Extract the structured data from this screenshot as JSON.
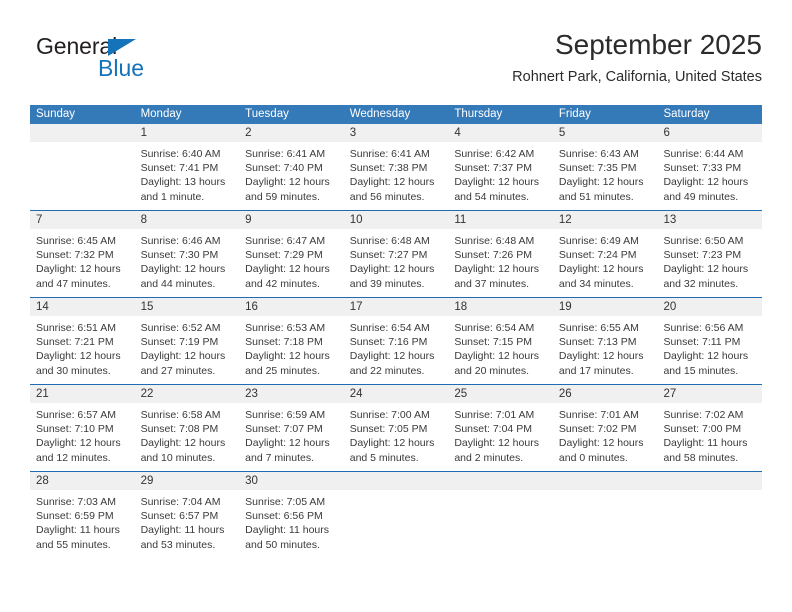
{
  "brand": {
    "name_top": "General",
    "name_bottom": "Blue",
    "accent_color": "#1573ba",
    "triangle_icon": "brand-triangle-icon"
  },
  "header": {
    "title": "September 2025",
    "subtitle": "Rohnert Park, California, United States"
  },
  "colors": {
    "header_bar": "#3479b8",
    "week_divider": "#1f6cb0",
    "day_band": "#f0f0f0",
    "text": "#3a3a3a"
  },
  "weekday_headers": [
    "Sunday",
    "Monday",
    "Tuesday",
    "Wednesday",
    "Thursday",
    "Friday",
    "Saturday"
  ],
  "weeks": [
    [
      {
        "day": "",
        "lines": []
      },
      {
        "day": "1",
        "lines": [
          "Sunrise: 6:40 AM",
          "Sunset: 7:41 PM",
          "Daylight: 13 hours",
          "and 1 minute."
        ]
      },
      {
        "day": "2",
        "lines": [
          "Sunrise: 6:41 AM",
          "Sunset: 7:40 PM",
          "Daylight: 12 hours",
          "and 59 minutes."
        ]
      },
      {
        "day": "3",
        "lines": [
          "Sunrise: 6:41 AM",
          "Sunset: 7:38 PM",
          "Daylight: 12 hours",
          "and 56 minutes."
        ]
      },
      {
        "day": "4",
        "lines": [
          "Sunrise: 6:42 AM",
          "Sunset: 7:37 PM",
          "Daylight: 12 hours",
          "and 54 minutes."
        ]
      },
      {
        "day": "5",
        "lines": [
          "Sunrise: 6:43 AM",
          "Sunset: 7:35 PM",
          "Daylight: 12 hours",
          "and 51 minutes."
        ]
      },
      {
        "day": "6",
        "lines": [
          "Sunrise: 6:44 AM",
          "Sunset: 7:33 PM",
          "Daylight: 12 hours",
          "and 49 minutes."
        ]
      }
    ],
    [
      {
        "day": "7",
        "lines": [
          "Sunrise: 6:45 AM",
          "Sunset: 7:32 PM",
          "Daylight: 12 hours",
          "and 47 minutes."
        ]
      },
      {
        "day": "8",
        "lines": [
          "Sunrise: 6:46 AM",
          "Sunset: 7:30 PM",
          "Daylight: 12 hours",
          "and 44 minutes."
        ]
      },
      {
        "day": "9",
        "lines": [
          "Sunrise: 6:47 AM",
          "Sunset: 7:29 PM",
          "Daylight: 12 hours",
          "and 42 minutes."
        ]
      },
      {
        "day": "10",
        "lines": [
          "Sunrise: 6:48 AM",
          "Sunset: 7:27 PM",
          "Daylight: 12 hours",
          "and 39 minutes."
        ]
      },
      {
        "day": "11",
        "lines": [
          "Sunrise: 6:48 AM",
          "Sunset: 7:26 PM",
          "Daylight: 12 hours",
          "and 37 minutes."
        ]
      },
      {
        "day": "12",
        "lines": [
          "Sunrise: 6:49 AM",
          "Sunset: 7:24 PM",
          "Daylight: 12 hours",
          "and 34 minutes."
        ]
      },
      {
        "day": "13",
        "lines": [
          "Sunrise: 6:50 AM",
          "Sunset: 7:23 PM",
          "Daylight: 12 hours",
          "and 32 minutes."
        ]
      }
    ],
    [
      {
        "day": "14",
        "lines": [
          "Sunrise: 6:51 AM",
          "Sunset: 7:21 PM",
          "Daylight: 12 hours",
          "and 30 minutes."
        ]
      },
      {
        "day": "15",
        "lines": [
          "Sunrise: 6:52 AM",
          "Sunset: 7:19 PM",
          "Daylight: 12 hours",
          "and 27 minutes."
        ]
      },
      {
        "day": "16",
        "lines": [
          "Sunrise: 6:53 AM",
          "Sunset: 7:18 PM",
          "Daylight: 12 hours",
          "and 25 minutes."
        ]
      },
      {
        "day": "17",
        "lines": [
          "Sunrise: 6:54 AM",
          "Sunset: 7:16 PM",
          "Daylight: 12 hours",
          "and 22 minutes."
        ]
      },
      {
        "day": "18",
        "lines": [
          "Sunrise: 6:54 AM",
          "Sunset: 7:15 PM",
          "Daylight: 12 hours",
          "and 20 minutes."
        ]
      },
      {
        "day": "19",
        "lines": [
          "Sunrise: 6:55 AM",
          "Sunset: 7:13 PM",
          "Daylight: 12 hours",
          "and 17 minutes."
        ]
      },
      {
        "day": "20",
        "lines": [
          "Sunrise: 6:56 AM",
          "Sunset: 7:11 PM",
          "Daylight: 12 hours",
          "and 15 minutes."
        ]
      }
    ],
    [
      {
        "day": "21",
        "lines": [
          "Sunrise: 6:57 AM",
          "Sunset: 7:10 PM",
          "Daylight: 12 hours",
          "and 12 minutes."
        ]
      },
      {
        "day": "22",
        "lines": [
          "Sunrise: 6:58 AM",
          "Sunset: 7:08 PM",
          "Daylight: 12 hours",
          "and 10 minutes."
        ]
      },
      {
        "day": "23",
        "lines": [
          "Sunrise: 6:59 AM",
          "Sunset: 7:07 PM",
          "Daylight: 12 hours",
          "and 7 minutes."
        ]
      },
      {
        "day": "24",
        "lines": [
          "Sunrise: 7:00 AM",
          "Sunset: 7:05 PM",
          "Daylight: 12 hours",
          "and 5 minutes."
        ]
      },
      {
        "day": "25",
        "lines": [
          "Sunrise: 7:01 AM",
          "Sunset: 7:04 PM",
          "Daylight: 12 hours",
          "and 2 minutes."
        ]
      },
      {
        "day": "26",
        "lines": [
          "Sunrise: 7:01 AM",
          "Sunset: 7:02 PM",
          "Daylight: 12 hours",
          "and 0 minutes."
        ]
      },
      {
        "day": "27",
        "lines": [
          "Sunrise: 7:02 AM",
          "Sunset: 7:00 PM",
          "Daylight: 11 hours",
          "and 58 minutes."
        ]
      }
    ],
    [
      {
        "day": "28",
        "lines": [
          "Sunrise: 7:03 AM",
          "Sunset: 6:59 PM",
          "Daylight: 11 hours",
          "and 55 minutes."
        ]
      },
      {
        "day": "29",
        "lines": [
          "Sunrise: 7:04 AM",
          "Sunset: 6:57 PM",
          "Daylight: 11 hours",
          "and 53 minutes."
        ]
      },
      {
        "day": "30",
        "lines": [
          "Sunrise: 7:05 AM",
          "Sunset: 6:56 PM",
          "Daylight: 11 hours",
          "and 50 minutes."
        ]
      },
      {
        "day": "",
        "lines": []
      },
      {
        "day": "",
        "lines": []
      },
      {
        "day": "",
        "lines": []
      },
      {
        "day": "",
        "lines": []
      }
    ]
  ]
}
